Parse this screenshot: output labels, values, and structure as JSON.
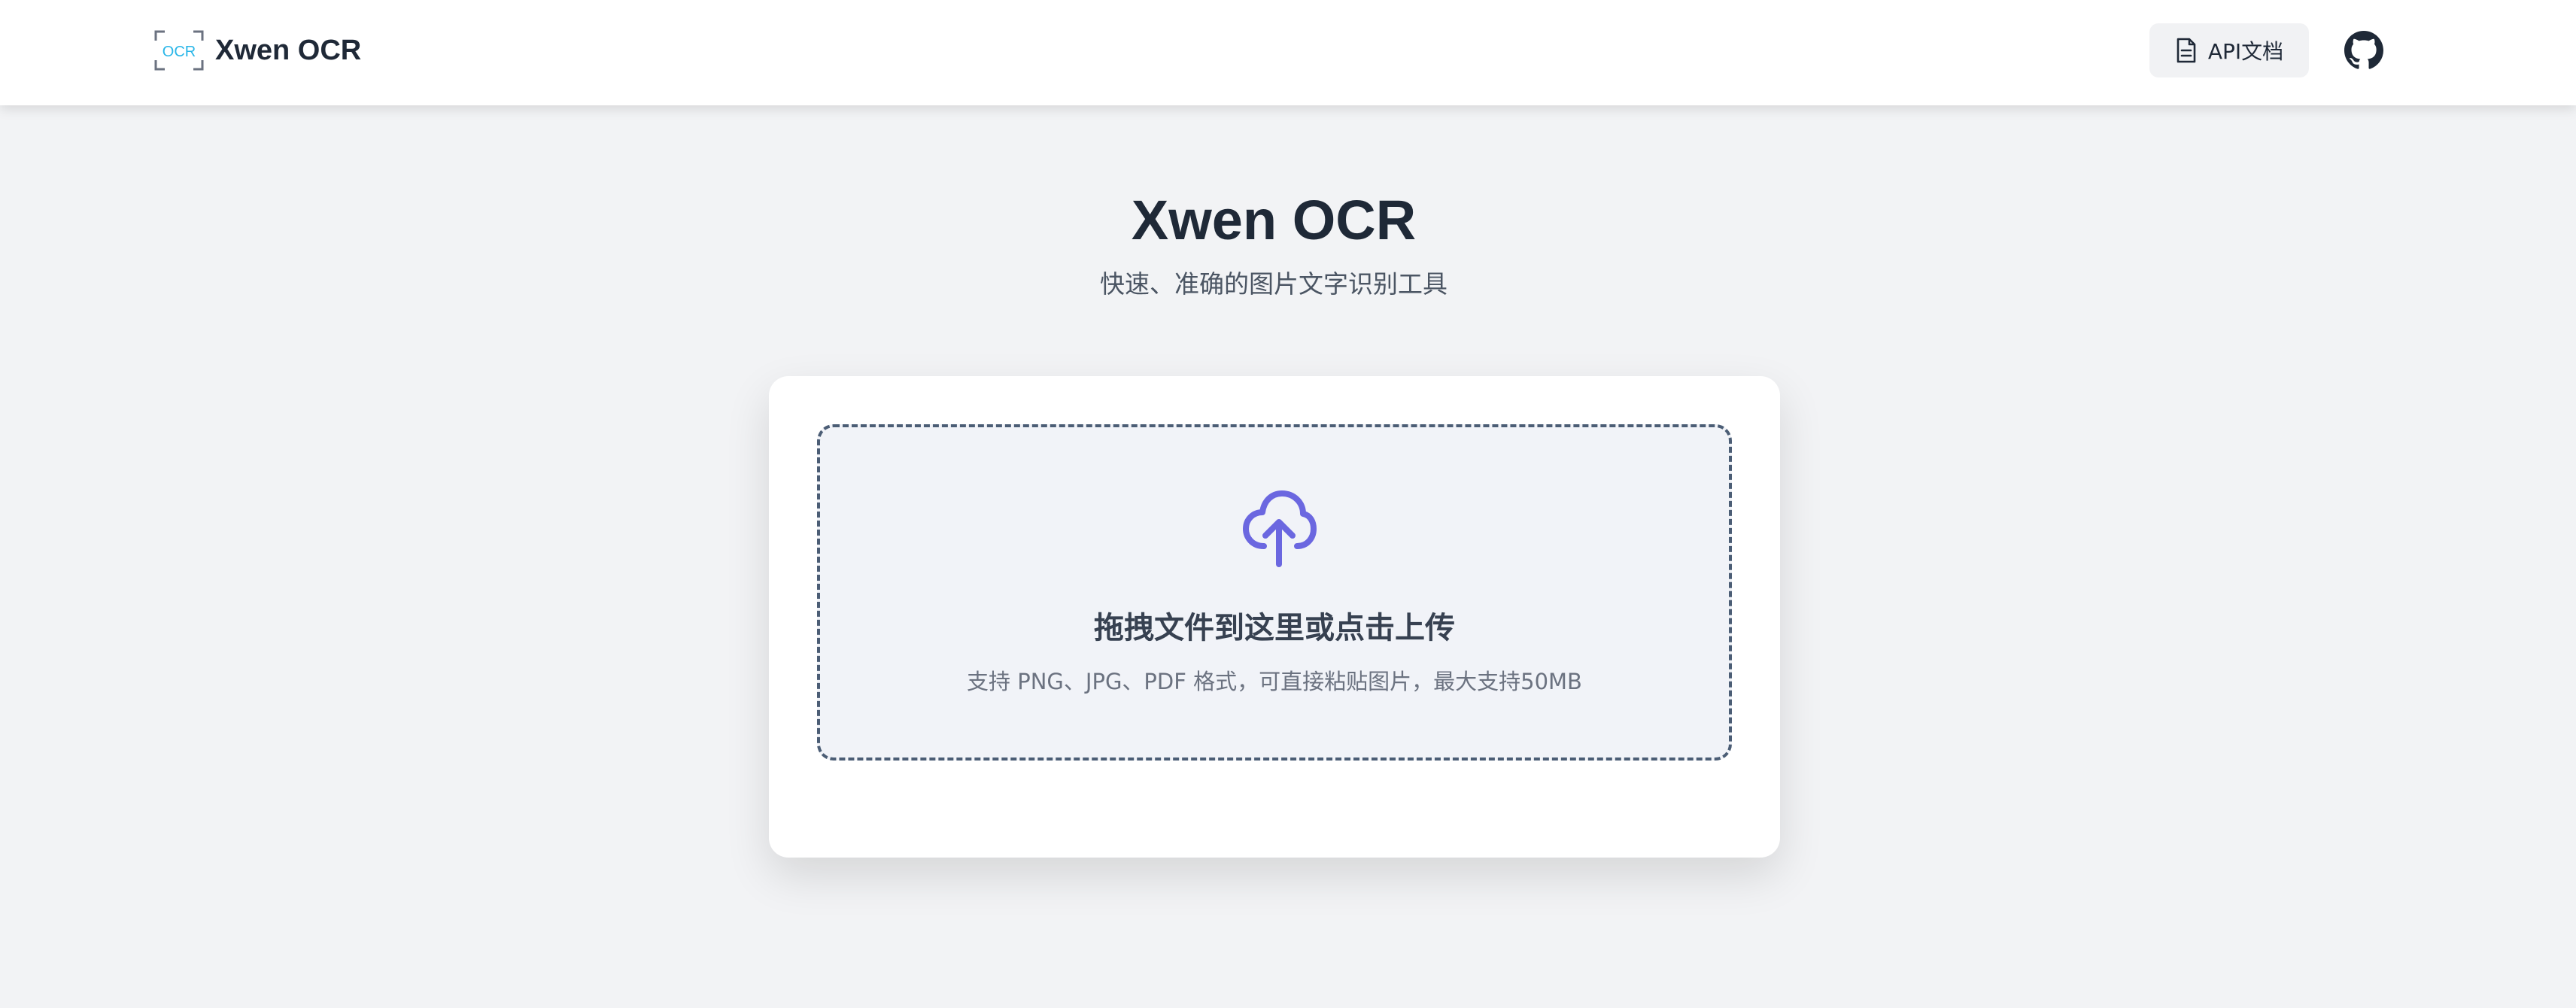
{
  "header": {
    "logo_text": "OCR",
    "app_name": "Xwen OCR",
    "api_docs_label": "API文档",
    "github_icon": "github-icon"
  },
  "hero": {
    "title": "Xwen OCR",
    "subtitle": "快速、准确的图片文字识别工具"
  },
  "upload": {
    "title": "拖拽文件到这里或点击上传",
    "hint": "支持 PNG、JPG、PDF 格式，可直接粘贴图片，最大支持50MB"
  },
  "colors": {
    "accent": "#6b67e0",
    "logo_accent": "#29b6e8",
    "background": "#f2f3f5",
    "dropzone_border": "#4b5d75"
  }
}
